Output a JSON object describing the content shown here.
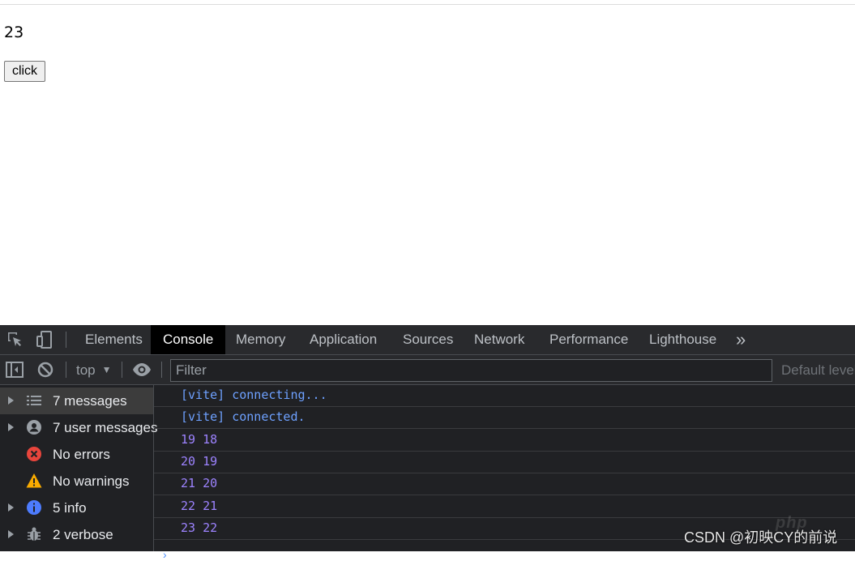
{
  "page": {
    "counter_value": "23",
    "button_label": "click"
  },
  "devtools": {
    "tabs": [
      {
        "label": "Elements",
        "active": false
      },
      {
        "label": "Console",
        "active": true
      },
      {
        "label": "Memory",
        "active": false
      },
      {
        "label": "Application",
        "active": false
      },
      {
        "label": "Sources",
        "active": false
      },
      {
        "label": "Network",
        "active": false
      },
      {
        "label": "Performance",
        "active": false
      },
      {
        "label": "Lighthouse",
        "active": false
      }
    ],
    "more_tabs_glyph": "»",
    "toolbar": {
      "context": "top",
      "filter_placeholder": "Filter",
      "levels": "Default levels"
    },
    "sidebar": [
      {
        "label": "7 messages",
        "icon": "list-icon",
        "selected": true
      },
      {
        "label": "7 user messages",
        "icon": "user-icon",
        "selected": false
      },
      {
        "label": "No errors",
        "icon": "error-icon",
        "selected": false
      },
      {
        "label": "No warnings",
        "icon": "warning-icon",
        "selected": false
      },
      {
        "label": "5 info",
        "icon": "info-icon",
        "selected": false
      },
      {
        "label": "2 verbose",
        "icon": "bug-icon",
        "selected": false
      }
    ],
    "console_lines": [
      {
        "text": "[vite] connecting...",
        "kind": "vite"
      },
      {
        "text": "[vite] connected.",
        "kind": "vite"
      },
      {
        "text": "19 18",
        "kind": "num"
      },
      {
        "text": "20 19",
        "kind": "num"
      },
      {
        "text": "21 20",
        "kind": "num"
      },
      {
        "text": "22 21",
        "kind": "num"
      },
      {
        "text": "23 22",
        "kind": "num"
      }
    ],
    "prompt": "›"
  },
  "watermark": {
    "logo_text": "php",
    "text": "CSDN @初映CY的前说"
  },
  "colors": {
    "devtools_bg": "#202124",
    "tabbar_bg": "#292a2d",
    "vite_text": "#6ea1ff",
    "number_text": "#9d83ff",
    "error_red": "#e8453c",
    "warning_yellow": "#f9ab00",
    "info_blue": "#4d7cfe"
  }
}
